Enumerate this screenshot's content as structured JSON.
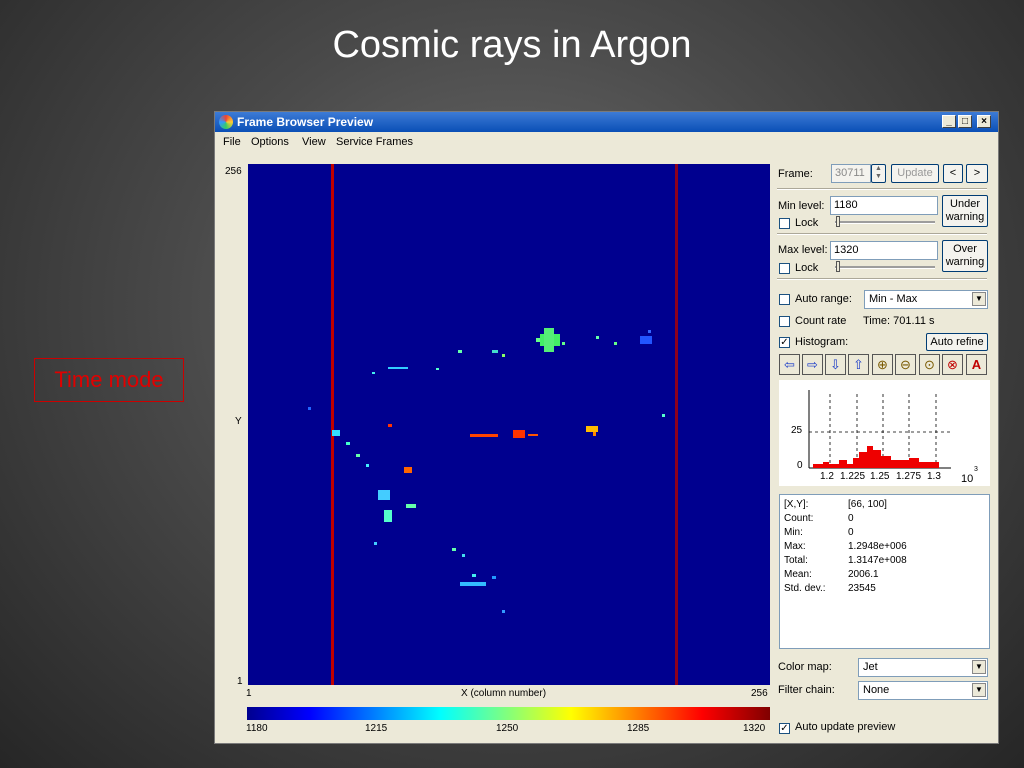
{
  "slide": {
    "title": "Cosmic rays in Argon",
    "side_label": "Time mode"
  },
  "window": {
    "title": "Frame Browser Preview",
    "controls": [
      "_",
      "□",
      "×"
    ]
  },
  "menu": [
    "File",
    "Options",
    "View",
    "Service Frames"
  ],
  "plot": {
    "y_top": "256",
    "y_label": "Y",
    "y_bottom": "1",
    "x_left": "1",
    "x_label": "X (column number)",
    "x_right": "256",
    "colorbar_ticks": [
      "1180",
      "1215",
      "1250",
      "1285",
      "1320"
    ],
    "colors": {
      "background": "#00008f",
      "column_line": "#c00000"
    }
  },
  "frame": {
    "label": "Frame:",
    "value": "30711",
    "update_label": "Update",
    "prev_label": "<",
    "next_label": ">"
  },
  "min_level": {
    "label": "Min level:",
    "value": "1180",
    "lock_label": "Lock",
    "warn_label_1": "Under",
    "warn_label_2": "warning"
  },
  "max_level": {
    "label": "Max level:",
    "value": "1320",
    "lock_label": "Lock",
    "warn_label_1": "Over",
    "warn_label_2": "warning"
  },
  "auto_range": {
    "label": "Auto range:",
    "value": "Min - Max",
    "checked": false
  },
  "count_rate": {
    "label": "Count rate",
    "checked": false,
    "time": "Time: 701.11 s"
  },
  "histogram": {
    "label": "Histogram:",
    "checked": true,
    "check_mark": "✓",
    "auto_refine_label": "Auto refine",
    "toolbar_icons": [
      "arrow-left-icon",
      "arrow-right-icon",
      "arrow-down-icon",
      "arrow-up-icon",
      "zoom-in-icon",
      "zoom-out-icon",
      "zoom-fit-icon",
      "zoom-reset-icon",
      "auto-scale-icon"
    ],
    "y_ticks": [
      "25",
      "0"
    ],
    "x_ticks": [
      "1.2",
      "1.225",
      "1.25",
      "1.275",
      "1.3"
    ],
    "x_multiplier": "10",
    "x_exponent": "3"
  },
  "stats": [
    {
      "key": "[X,Y]:",
      "value": "[66, 100]"
    },
    {
      "key": "Count:",
      "value": "0"
    },
    {
      "key": "Min:",
      "value": "0"
    },
    {
      "key": "Max:",
      "value": "1.2948e+006"
    },
    {
      "key": "Total:",
      "value": "1.3147e+008"
    },
    {
      "key": "Mean:",
      "value": "2006.1"
    },
    {
      "key": "Std. dev.:",
      "value": "23545"
    }
  ],
  "color_map": {
    "label": "Color map:",
    "value": "Jet"
  },
  "filter_chain": {
    "label": "Filter chain:",
    "value": "None"
  },
  "auto_update": {
    "label": "Auto update preview",
    "checked": true
  }
}
